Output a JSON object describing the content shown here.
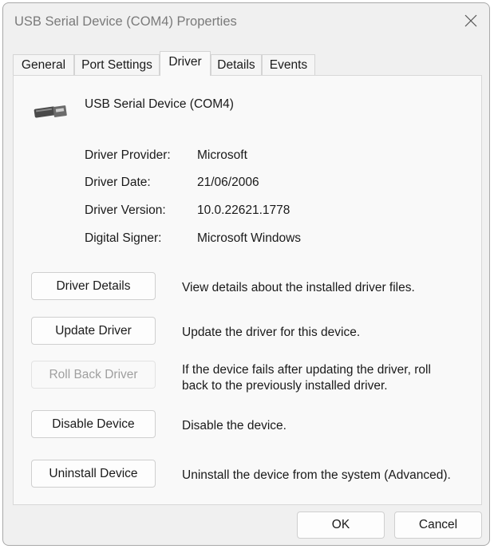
{
  "window": {
    "title": "USB Serial Device (COM4) Properties"
  },
  "tabs": [
    {
      "label": "General"
    },
    {
      "label": "Port Settings"
    },
    {
      "label": "Driver",
      "active": true
    },
    {
      "label": "Details"
    },
    {
      "label": "Events"
    }
  ],
  "device": {
    "name": "USB Serial Device (COM4)",
    "icon": "usb-connector-icon"
  },
  "driver_info": [
    {
      "label": "Driver Provider:",
      "value": "Microsoft"
    },
    {
      "label": "Driver Date:",
      "value": "21/06/2006"
    },
    {
      "label": "Driver Version:",
      "value": "10.0.22621.1778"
    },
    {
      "label": "Digital Signer:",
      "value": "Microsoft Windows"
    }
  ],
  "actions": [
    {
      "label": "Driver Details",
      "description": "View details about the installed driver files.",
      "enabled": true
    },
    {
      "label": "Update Driver",
      "description": "Update the driver for this device.",
      "enabled": true
    },
    {
      "label": "Roll Back Driver",
      "description": "If the device fails after updating the driver, roll back to the previously installed driver.",
      "enabled": false
    },
    {
      "label": "Disable Device",
      "description": "Disable the device.",
      "enabled": true
    },
    {
      "label": "Uninstall Device",
      "description": "Uninstall the device from the system (Advanced).",
      "enabled": true
    }
  ],
  "footer": {
    "ok_label": "OK",
    "cancel_label": "Cancel"
  },
  "colors": {
    "window_bg": "#f0f0f0",
    "panel_bg": "#f9f9f9",
    "disabled_text": "#9f9f9f",
    "title_text": "#7a7a7a"
  }
}
